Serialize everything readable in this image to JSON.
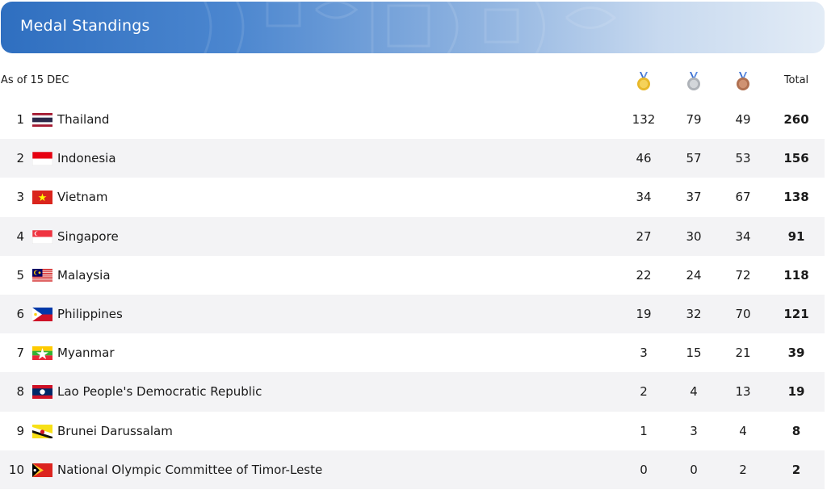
{
  "header": {
    "title": "Medal Standings"
  },
  "subhead": {
    "as_of": "As of 15 DEC",
    "total_label": "Total",
    "medal_icons": [
      "gold-medal-icon",
      "silver-medal-icon",
      "bronze-medal-icon"
    ]
  },
  "colors": {
    "gold": "#e8b82a",
    "silver": "#b6b9bf",
    "bronze": "#b8734f",
    "header_accent": "#2f6fc0"
  },
  "rows": [
    {
      "rank": "1",
      "country": "Thailand",
      "flag": "thailand-flag-icon",
      "gold": "132",
      "silver": "79",
      "bronze": "49",
      "total": "260"
    },
    {
      "rank": "2",
      "country": "Indonesia",
      "flag": "indonesia-flag-icon",
      "gold": "46",
      "silver": "57",
      "bronze": "53",
      "total": "156"
    },
    {
      "rank": "3",
      "country": "Vietnam",
      "flag": "vietnam-flag-icon",
      "gold": "34",
      "silver": "37",
      "bronze": "67",
      "total": "138"
    },
    {
      "rank": "4",
      "country": "Singapore",
      "flag": "singapore-flag-icon",
      "gold": "27",
      "silver": "30",
      "bronze": "34",
      "total": "91"
    },
    {
      "rank": "5",
      "country": "Malaysia",
      "flag": "malaysia-flag-icon",
      "gold": "22",
      "silver": "24",
      "bronze": "72",
      "total": "118"
    },
    {
      "rank": "6",
      "country": "Philippines",
      "flag": "philippines-flag-icon",
      "gold": "19",
      "silver": "32",
      "bronze": "70",
      "total": "121"
    },
    {
      "rank": "7",
      "country": "Myanmar",
      "flag": "myanmar-flag-icon",
      "gold": "3",
      "silver": "15",
      "bronze": "21",
      "total": "39"
    },
    {
      "rank": "8",
      "country": "Lao People's Democratic Republic",
      "flag": "laos-flag-icon",
      "gold": "2",
      "silver": "4",
      "bronze": "13",
      "total": "19"
    },
    {
      "rank": "9",
      "country": "Brunei Darussalam",
      "flag": "brunei-flag-icon",
      "gold": "1",
      "silver": "3",
      "bronze": "4",
      "total": "8"
    },
    {
      "rank": "10",
      "country": "National Olympic Committee of Timor-Leste",
      "flag": "timor-leste-flag-icon",
      "gold": "0",
      "silver": "0",
      "bronze": "2",
      "total": "2"
    }
  ]
}
